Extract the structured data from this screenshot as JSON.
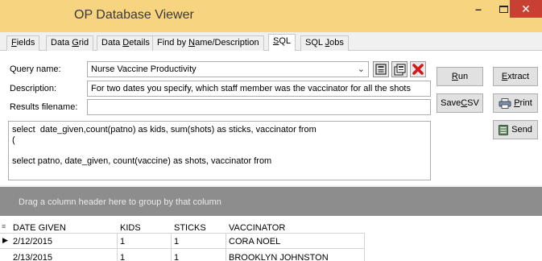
{
  "window": {
    "title": "OP Database Viewer"
  },
  "tabs": [
    {
      "pre": "",
      "key": "F",
      "post": "ields"
    },
    {
      "pre": "Data ",
      "key": "G",
      "post": "rid"
    },
    {
      "pre": "Data ",
      "key": "D",
      "post": "etails"
    },
    {
      "pre": "Find by ",
      "key": "N",
      "post": "ame/Description"
    },
    {
      "pre": "",
      "key": "S",
      "post": "QL"
    },
    {
      "pre": "SQL ",
      "key": "J",
      "post": "obs"
    }
  ],
  "form": {
    "query_name_label": "Query name:",
    "query_name_value": "Nurse Vaccine Productivity",
    "description_label": "Description:",
    "description_value": "For two dates you specify, which staff member was the vaccinator for all the shots",
    "results_filename_label": "Results filename:",
    "results_filename_value": ""
  },
  "buttons": {
    "run": {
      "key": "R",
      "post": "un"
    },
    "extract": {
      "key": "E",
      "post": "xtract"
    },
    "save_csv": {
      "pre": "Save ",
      "key": "C",
      "post": "SV"
    },
    "print": {
      "key": "P",
      "post": "rint"
    },
    "send": "Send"
  },
  "sql_lines": [
    "select  date_given,count(patno) as kids, sum(shots) as sticks, vaccinator from",
    "(",
    "",
    "select patno, date_given, count(vaccine) as shots, vaccinator from"
  ],
  "group_bar_text": "Drag a column header here to group by that column",
  "grid": {
    "columns": [
      "DATE GIVEN",
      "KIDS",
      "STICKS",
      "VACCINATOR"
    ],
    "rows": [
      [
        "2/12/2015",
        "1",
        "1",
        "CORA NOEL"
      ],
      [
        "2/13/2015",
        "1",
        "1",
        "BROOKLYN JOHNSTON"
      ]
    ]
  }
}
